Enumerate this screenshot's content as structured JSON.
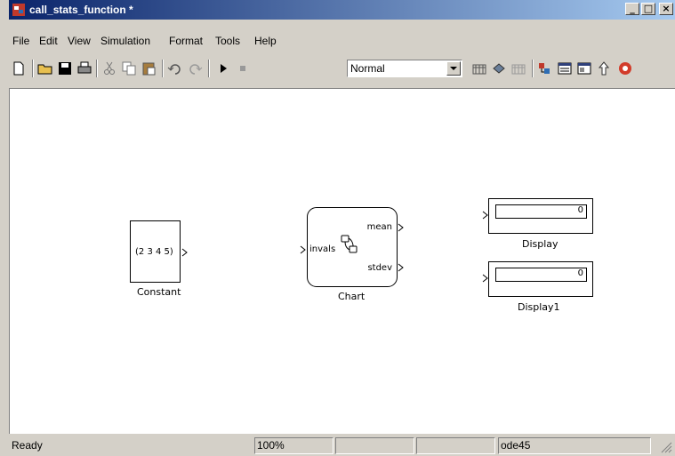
{
  "window": {
    "title": "call_stats_function *",
    "minimize": "_",
    "maximize": "□",
    "close": "×"
  },
  "menu": [
    "File",
    "Edit",
    "View",
    "Simulation",
    "Format",
    "Tools",
    "Help"
  ],
  "toolbar": {
    "icons": [
      "new-file-icon",
      "open-folder-icon",
      "save-icon",
      "print-icon",
      "cut-icon",
      "copy-icon",
      "paste-icon",
      "undo-icon",
      "redo-icon",
      "play-icon",
      "stop-icon",
      "build-icon",
      "update-diagram-icon",
      "build-subsystem-icon",
      "library-browser-icon",
      "model-explorer-icon",
      "debugger-icon",
      "navigate-up-icon",
      "target-icon"
    ],
    "sim_mode": "Normal"
  },
  "blocks": {
    "constant": {
      "value": "(2  3  4  5)",
      "label": "Constant"
    },
    "chart": {
      "label": "Chart",
      "input": "invals",
      "output1": "mean",
      "output2": "stdev"
    },
    "display": {
      "value": "0",
      "label": "Display"
    },
    "display1": {
      "value": "0",
      "label": "Display1"
    }
  },
  "status": {
    "ready": "Ready",
    "zoom": "100%",
    "pane3": "",
    "pane4": "",
    "solver": "ode45"
  }
}
